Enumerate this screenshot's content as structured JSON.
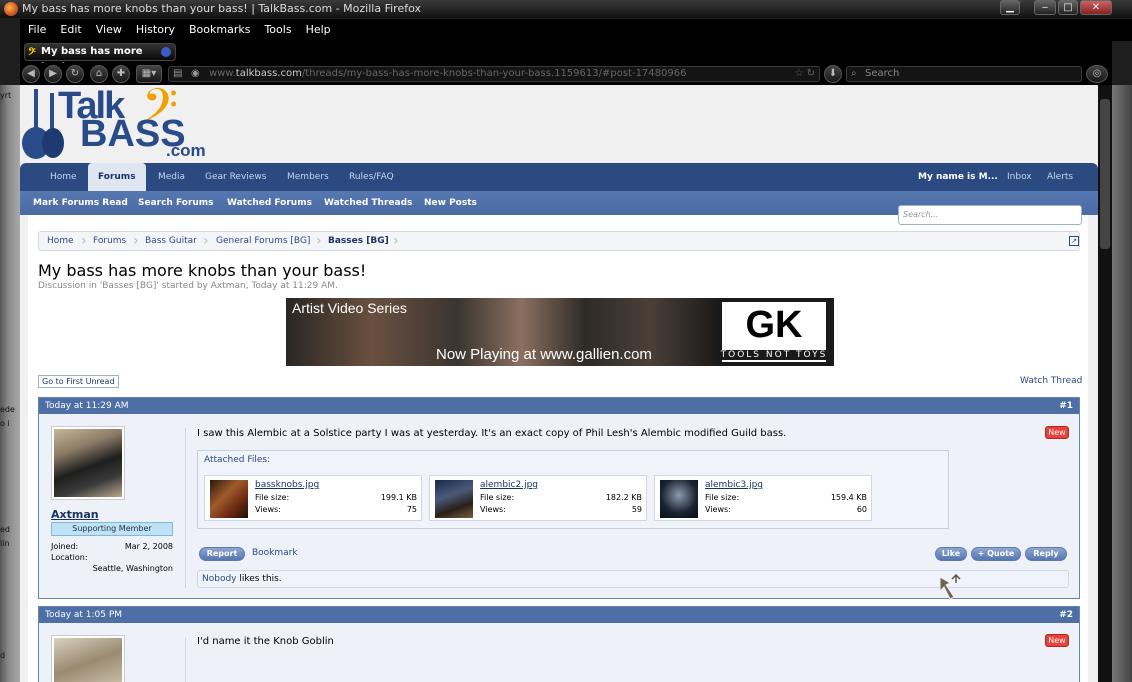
{
  "window": {
    "title": "My bass has more knobs than your bass! | TalkBass.com - Mozilla Firefox"
  },
  "menu": [
    "File",
    "Edit",
    "View",
    "History",
    "Bookmarks",
    "Tools",
    "Help"
  ],
  "tab": {
    "label": "My bass has more knobs t..."
  },
  "address": {
    "host": "talkbass.com",
    "url_rest": "/threads/my-bass-has-more-knobs-than-your-bass.1159613/#post-17480966",
    "url_prefix": "www."
  },
  "browser_search": {
    "placeholder": "Search"
  },
  "logo": {
    "line1": "Talk",
    "line2": "BASS",
    "line3": ".com"
  },
  "nav": {
    "tabs": [
      "Home",
      "Forums",
      "Media",
      "Gear Reviews",
      "Members",
      "Rules/FAQ"
    ],
    "selected": "Forums",
    "user": "My name is M...",
    "inbox": "Inbox",
    "alerts": "Alerts"
  },
  "subnav": [
    "Mark Forums Read",
    "Search Forums",
    "Watched Forums",
    "Watched Threads",
    "New Posts"
  ],
  "site_search": {
    "placeholder": "Search..."
  },
  "breadcrumb": [
    "Home",
    "Forums",
    "Bass Guitar",
    "General Forums [BG]",
    "Basses [BG]"
  ],
  "thread": {
    "title": "My bass has more knobs than your bass!",
    "meta": "Discussion in 'Basses [BG]' started by Axtman, Today at 11:29 AM."
  },
  "banner": {
    "headline": "Artist Video Series",
    "tagline": "Now Playing at www.gallien.com",
    "brand": "GK",
    "slogan": "TOOLS NOT TOYS"
  },
  "go_first_unread": "Go to First Unread",
  "watch_thread": "Watch Thread",
  "posts": [
    {
      "time": "Today at 11:29 AM",
      "number": "#1",
      "username": "Axtman",
      "user_title": "Supporting Member",
      "joined_label": "Joined:",
      "joined": "Mar 2, 2008",
      "location_label": "Location:",
      "location": "Seattle, Washington",
      "message": "I saw this Alembic at a Solstice party I was at yesterday. It's an exact copy of Phil Lesh's Alembic modified Guild bass.",
      "new_badge": "New",
      "attached_label": "Attached Files:",
      "attachments": [
        {
          "name": "bassknobs.jpg",
          "size_label": "File size:",
          "size": "199.1 KB",
          "views_label": "Views:",
          "views": "75"
        },
        {
          "name": "alembic2.jpg",
          "size_label": "File size:",
          "size": "182.2 KB",
          "views_label": "Views:",
          "views": "59"
        },
        {
          "name": "alembic3.jpg",
          "size_label": "File size:",
          "size": "159.4 KB",
          "views_label": "Views:",
          "views": "60"
        }
      ],
      "report": "Report",
      "bookmark": "Bookmark",
      "like": "Like",
      "quote": "+ Quote",
      "reply": "Reply",
      "likes_who": "Nobody",
      "likes_text": " likes this."
    },
    {
      "time": "Today at 1:05 PM",
      "number": "#2",
      "message": "I'd name it the Knob Goblin",
      "new_badge": "New"
    }
  ],
  "colors": {
    "nav": "#2b4a82",
    "subnav": "#4e6ea6",
    "accent": "#f0a000",
    "new_badge": "#e8413a"
  }
}
